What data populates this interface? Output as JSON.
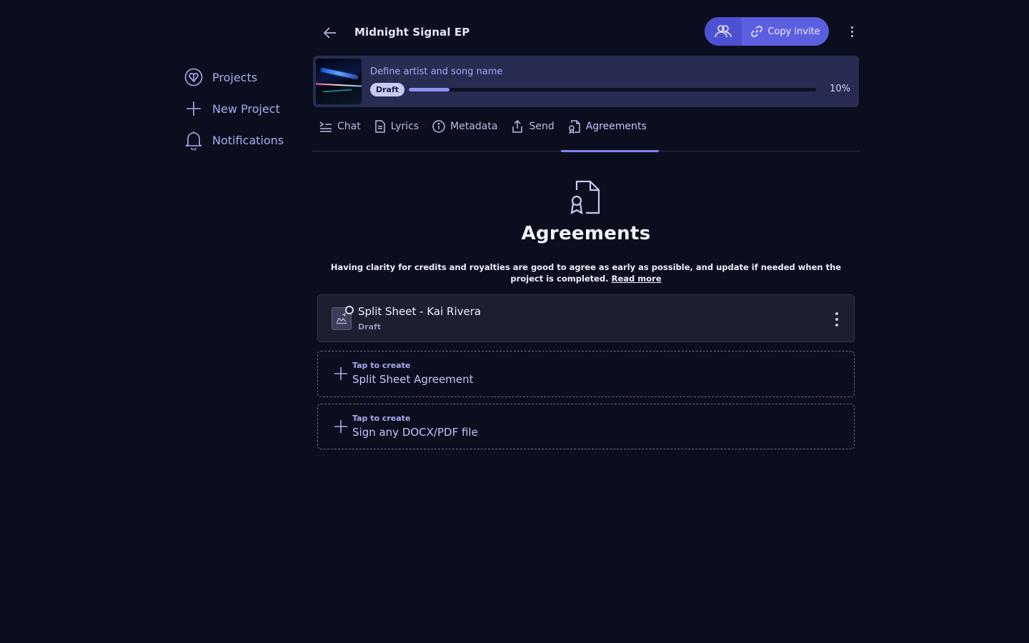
{
  "sidebar": {
    "items": [
      {
        "label": "Projects",
        "icon": "logo-heart-icon"
      },
      {
        "label": "New Project",
        "icon": "plus-icon"
      },
      {
        "label": "Notifications",
        "icon": "bell-icon"
      }
    ]
  },
  "header": {
    "project_title": "Midnight Signal EP",
    "copy_invite_label": "Copy invite"
  },
  "progress": {
    "step_label": "Define artist and song name",
    "status_badge": "Draft",
    "percent_text": "10%",
    "percent_value": 0.1
  },
  "tabs": [
    {
      "label": "Chat",
      "icon": "chat-lines-icon"
    },
    {
      "label": "Lyrics",
      "icon": "document-icon"
    },
    {
      "label": "Metadata",
      "icon": "info-icon"
    },
    {
      "label": "Send",
      "icon": "share-icon"
    },
    {
      "label": "Agreements",
      "icon": "agreement-icon",
      "active": true
    }
  ],
  "agreements": {
    "title": "Agreements",
    "description": "Having clarity for credits and royalties are good to agree as early as possible, and update if needed when the project is completed.",
    "read_more": "Read more",
    "items": [
      {
        "title": "Split Sheet - Kai Rivera",
        "status": "Draft"
      }
    ],
    "create_options": [
      {
        "hint": "Tap to create",
        "label": "Split Sheet Agreement"
      },
      {
        "hint": "Tap to create",
        "label": "Sign any DOCX/PDF file"
      }
    ]
  },
  "colors": {
    "background": "#0b0e1e",
    "accent": "#5c5fe0",
    "progress_fill": "#8e91f3",
    "card": "#292c52"
  }
}
